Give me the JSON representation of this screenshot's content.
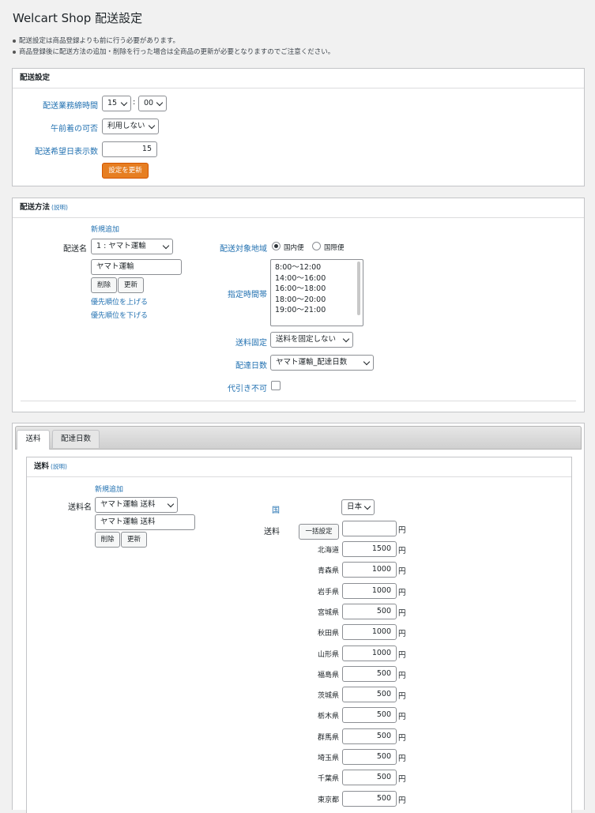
{
  "page": {
    "title": "Welcart Shop 配送設定",
    "notes": [
      "配送設定は商品登録よりも前に行う必要があります。",
      "商品登録後に配送方法の追加・削除を行った場合は全商品の更新が必要となりますのでご注意ください。"
    ]
  },
  "shipping_settings": {
    "heading": "配送設定",
    "closing_time_label": "配送業務締時間",
    "closing_hour": "15",
    "closing_separator": ":",
    "closing_minute": "00",
    "morning_label": "午前着の可否",
    "morning_value": "利用しない",
    "days_label": "配送希望日表示数",
    "days_value": "15",
    "update_button": "設定を更新"
  },
  "delivery_method": {
    "heading": "配送方法",
    "help": "(説明)",
    "add_new": "新規追加",
    "name_label": "配送名",
    "name_select": "1 : ヤマト運輸",
    "name_input": "ヤマト運輸",
    "delete_button": "削除",
    "update_button": "更新",
    "priority_up": "優先順位を上げる",
    "priority_down": "優先順位を下げる",
    "region_label": "配送対象地域",
    "region_domestic": "国内便",
    "region_international": "国際便",
    "time_label": "指定時間帯",
    "time_slots": "8:00〜12:00\n14:00〜16:00\n16:00〜18:00\n18:00〜20:00\n19:00〜21:00",
    "fixed_label": "送料固定",
    "fixed_value": "送料を固定しない",
    "delivery_days_label": "配達日数",
    "delivery_days_value": "ヤマト運輸_配達日数",
    "cod_label": "代引き不可"
  },
  "tabs": {
    "tab1": "送料",
    "tab2": "配達日数"
  },
  "postage": {
    "heading": "送料",
    "help": "(説明)",
    "add_new": "新規追加",
    "name_label": "送料名",
    "name_select": "ヤマト運輸 送料",
    "name_input": "ヤマト運輸 送料",
    "delete_button": "削除",
    "update_button": "更新",
    "country_label": "国",
    "country_value": "日本",
    "fee_label": "送料",
    "bulk_button": "一括設定",
    "bulk_value": "",
    "yen": "円",
    "prefectures": [
      {
        "name": "北海道",
        "fee": "1500"
      },
      {
        "name": "青森県",
        "fee": "1000"
      },
      {
        "name": "岩手県",
        "fee": "1000"
      },
      {
        "name": "宮城県",
        "fee": "500"
      },
      {
        "name": "秋田県",
        "fee": "1000"
      },
      {
        "name": "山形県",
        "fee": "1000"
      },
      {
        "name": "福島県",
        "fee": "500"
      },
      {
        "name": "茨城県",
        "fee": "500"
      },
      {
        "name": "栃木県",
        "fee": "500"
      },
      {
        "name": "群馬県",
        "fee": "500"
      },
      {
        "name": "埼玉県",
        "fee": "500"
      },
      {
        "name": "千葉県",
        "fee": "500"
      },
      {
        "name": "東京都",
        "fee": "500"
      }
    ]
  }
}
